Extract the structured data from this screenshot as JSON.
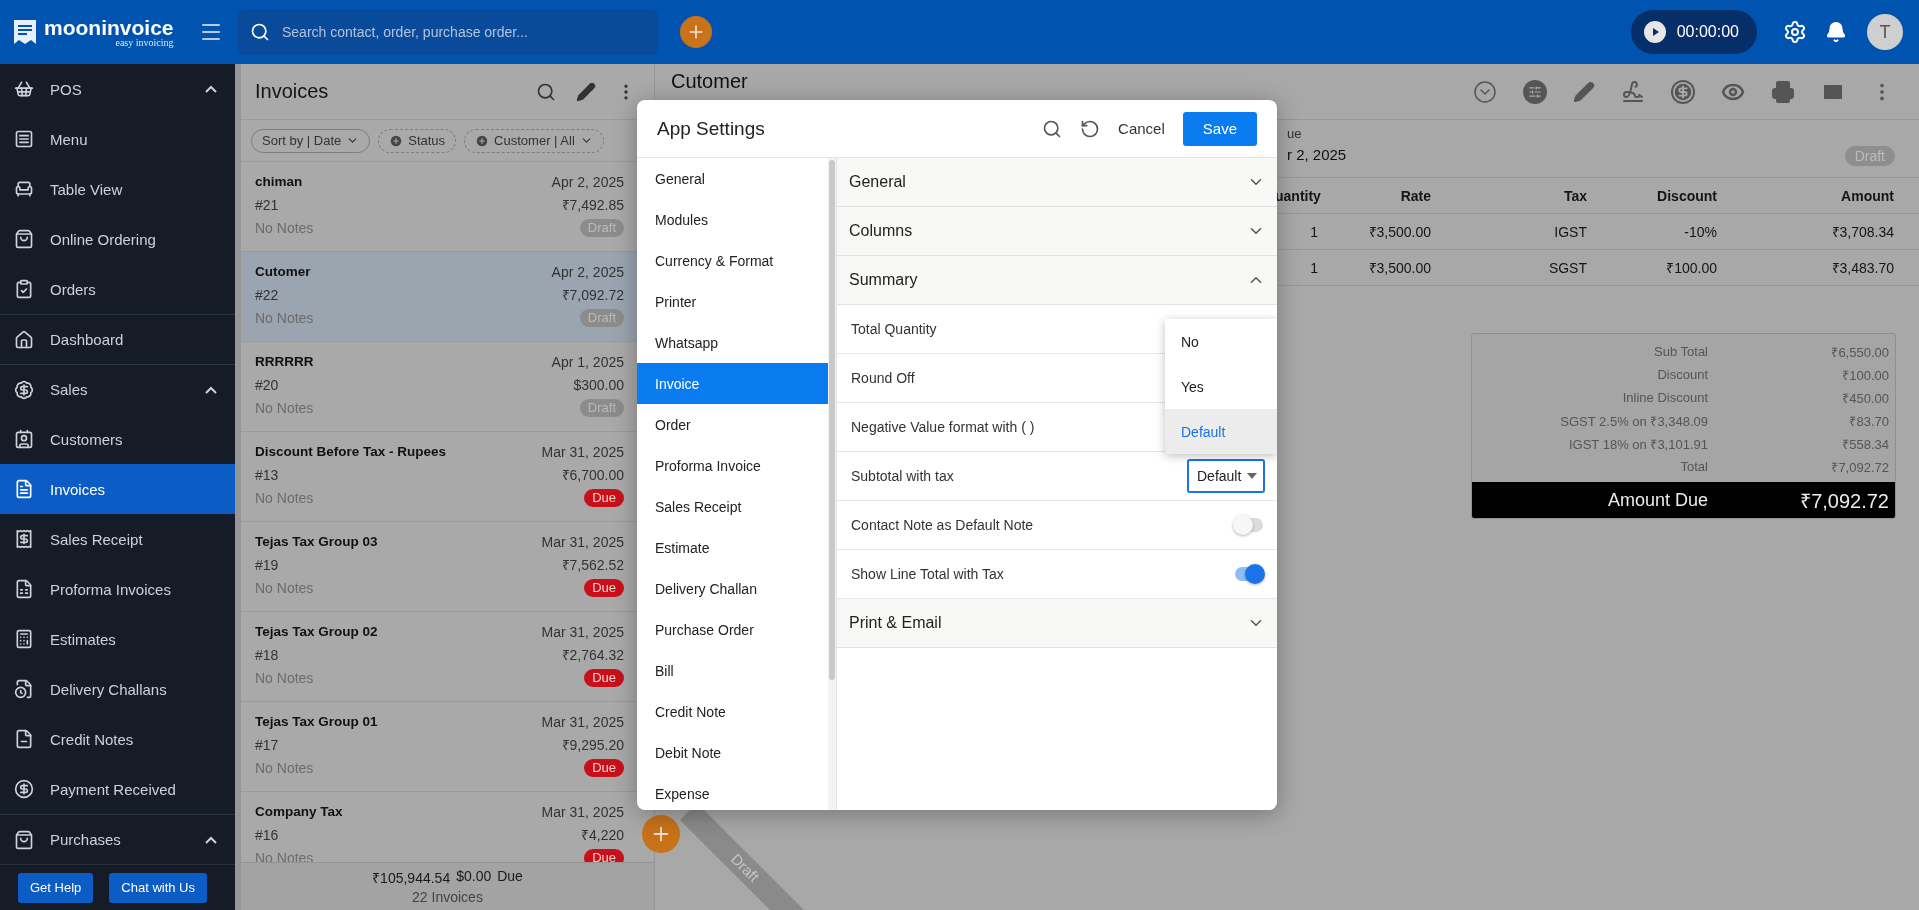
{
  "topbar": {
    "brand": "mooninvoice",
    "tagline": "easy invoicing",
    "search": {
      "placeholder": "Search contact, order, purchase order..."
    },
    "timer": "00:00:00",
    "avatar": "T"
  },
  "sidebar": {
    "items": [
      {
        "label": "POS",
        "kind": "section",
        "expanded": true,
        "selected": false
      },
      {
        "label": "Menu",
        "kind": "item",
        "selected": false
      },
      {
        "label": "Table View",
        "kind": "item",
        "selected": false
      },
      {
        "label": "Online Ordering",
        "kind": "item",
        "selected": false
      },
      {
        "label": "Orders",
        "kind": "item",
        "selected": false
      },
      {
        "label": "Dashboard",
        "kind": "single",
        "selected": false
      },
      {
        "label": "Sales",
        "kind": "section",
        "expanded": true,
        "selected": false
      },
      {
        "label": "Customers",
        "kind": "item",
        "selected": false
      },
      {
        "label": "Invoices",
        "kind": "item",
        "selected": true
      },
      {
        "label": "Sales Receipt",
        "kind": "item",
        "selected": false
      },
      {
        "label": "Proforma Invoices",
        "kind": "item",
        "selected": false
      },
      {
        "label": "Estimates",
        "kind": "item",
        "selected": false
      },
      {
        "label": "Delivery Challans",
        "kind": "item",
        "selected": false
      },
      {
        "label": "Credit Notes",
        "kind": "item",
        "selected": false
      },
      {
        "label": "Payment Received",
        "kind": "item",
        "selected": false
      },
      {
        "label": "Purchases",
        "kind": "section",
        "expanded": true,
        "selected": false
      }
    ],
    "buttons": [
      "Get Help",
      "Chat with Us"
    ]
  },
  "invoice_list": {
    "title": "Invoices",
    "filters": [
      {
        "label": "Sort by | Date",
        "kind": "sort"
      },
      {
        "label": "Status",
        "kind": "add"
      },
      {
        "label": "Customer | All",
        "kind": "add-select"
      }
    ],
    "items": [
      {
        "name": "chiman",
        "date": "Apr 2, 2025",
        "number": "#21",
        "amount": "₹7,492.85",
        "notes": "No Notes",
        "status": {
          "label": "Draft",
          "kind": "draft"
        },
        "selected": false
      },
      {
        "name": "Cutomer",
        "date": "Apr 2, 2025",
        "number": "#22",
        "amount": "₹7,092.72",
        "notes": "No Notes",
        "status": {
          "label": "Draft",
          "kind": "draft"
        },
        "selected": true
      },
      {
        "name": "RRRRRR",
        "date": "Apr 1, 2025",
        "number": "#20",
        "amount": "$300.00",
        "notes": "No Notes",
        "status": {
          "label": "Draft",
          "kind": "draft"
        },
        "selected": false
      },
      {
        "name": "Discount Before Tax - Rupees",
        "date": "Mar 31, 2025",
        "number": "#13",
        "amount": "₹6,700.00",
        "notes": "No Notes",
        "status": {
          "label": "Due",
          "kind": "due"
        },
        "selected": false
      },
      {
        "name": "Tejas Tax Group 03",
        "date": "Mar 31, 2025",
        "number": "#19",
        "amount": "₹7,562.52",
        "notes": "No Notes",
        "status": {
          "label": "Due",
          "kind": "due"
        },
        "selected": false
      },
      {
        "name": "Tejas Tax Group 02",
        "date": "Mar 31, 2025",
        "number": "#18",
        "amount": "₹2,764.32",
        "notes": "No Notes",
        "status": {
          "label": "Due",
          "kind": "due"
        },
        "selected": false
      },
      {
        "name": "Tejas Tax Group 01",
        "date": "Mar 31, 2025",
        "number": "#17",
        "amount": "₹9,295.20",
        "notes": "No Notes",
        "status": {
          "label": "Due",
          "kind": "due"
        },
        "selected": false
      },
      {
        "name": "Company Tax",
        "date": "Mar 31, 2025",
        "number": "#16",
        "amount": "₹4,220",
        "notes": "No Notes",
        "status": {
          "label": "Due",
          "kind": "due"
        },
        "selected": false
      }
    ],
    "footer": {
      "total": "₹105,944.54",
      "paid": "$0.00",
      "due_label": "Due",
      "count": "22 Invoices"
    }
  },
  "detail": {
    "title": "Cutomer",
    "fragment_label": "ue",
    "fragment_date": "r 2, 2025",
    "status": "Draft",
    "columns": [
      "uantity",
      "Rate",
      "Tax",
      "Discount",
      "Amount"
    ],
    "rows": [
      [
        "1",
        "₹3,500.00",
        "IGST",
        "-10%",
        "₹3,708.34"
      ],
      [
        "1",
        "₹3,500.00",
        "SGST",
        "₹100.00",
        "₹3,483.70"
      ]
    ],
    "summary": [
      {
        "label": "Sub Total",
        "value": "₹6,550.00"
      },
      {
        "label": "Discount",
        "value": "₹100.00"
      },
      {
        "label": "Inline Discount",
        "value": "₹450.00"
      },
      {
        "label": "SGST 2.5% on ₹3,348.09",
        "value": "₹83.70"
      },
      {
        "label": "IGST 18% on ₹3,101.91",
        "value": "₹558.34"
      },
      {
        "label": "Total",
        "value": "₹7,092.72"
      }
    ],
    "amount_due": {
      "label": "Amount Due",
      "value": "₹7,092.72"
    },
    "ribbon": "Draft"
  },
  "modal": {
    "title": "App Settings",
    "cancel": "Cancel",
    "save": "Save",
    "nav": [
      {
        "label": "General",
        "selected": false
      },
      {
        "label": "Modules",
        "selected": false
      },
      {
        "label": "Currency & Format",
        "selected": false
      },
      {
        "label": "Printer",
        "selected": false
      },
      {
        "label": "Whatsapp",
        "selected": false
      },
      {
        "label": "Invoice",
        "selected": true
      },
      {
        "label": "Order",
        "selected": false
      },
      {
        "label": "Proforma Invoice",
        "selected": false
      },
      {
        "label": "Sales Receipt",
        "selected": false
      },
      {
        "label": "Estimate",
        "selected": false
      },
      {
        "label": "Delivery Challan",
        "selected": false
      },
      {
        "label": "Purchase Order",
        "selected": false
      },
      {
        "label": "Bill",
        "selected": false
      },
      {
        "label": "Credit Note",
        "selected": false
      },
      {
        "label": "Debit Note",
        "selected": false
      },
      {
        "label": "Expense",
        "selected": false
      }
    ],
    "sections": [
      {
        "title": "General",
        "expanded": false
      },
      {
        "title": "Columns",
        "expanded": false
      },
      {
        "title": "Summary",
        "expanded": true,
        "rows": [
          {
            "label": "Total Quantity",
            "kind": "select"
          },
          {
            "label": "Round Off",
            "kind": "select"
          },
          {
            "label": "Negative Value format with ( )",
            "kind": "select"
          },
          {
            "label": "Subtotal with tax",
            "kind": "select",
            "value": "Default",
            "focused": true,
            "open": true,
            "options": [
              {
                "label": "No",
                "selected": false
              },
              {
                "label": "Yes",
                "selected": false
              },
              {
                "label": "Default",
                "selected": true
              }
            ]
          },
          {
            "label": "Contact Note as Default Note",
            "kind": "toggle",
            "on": false
          },
          {
            "label": "Show Line Total with Tax",
            "kind": "toggle",
            "on": true
          }
        ]
      },
      {
        "title": "Print & Email",
        "expanded": false
      }
    ]
  }
}
